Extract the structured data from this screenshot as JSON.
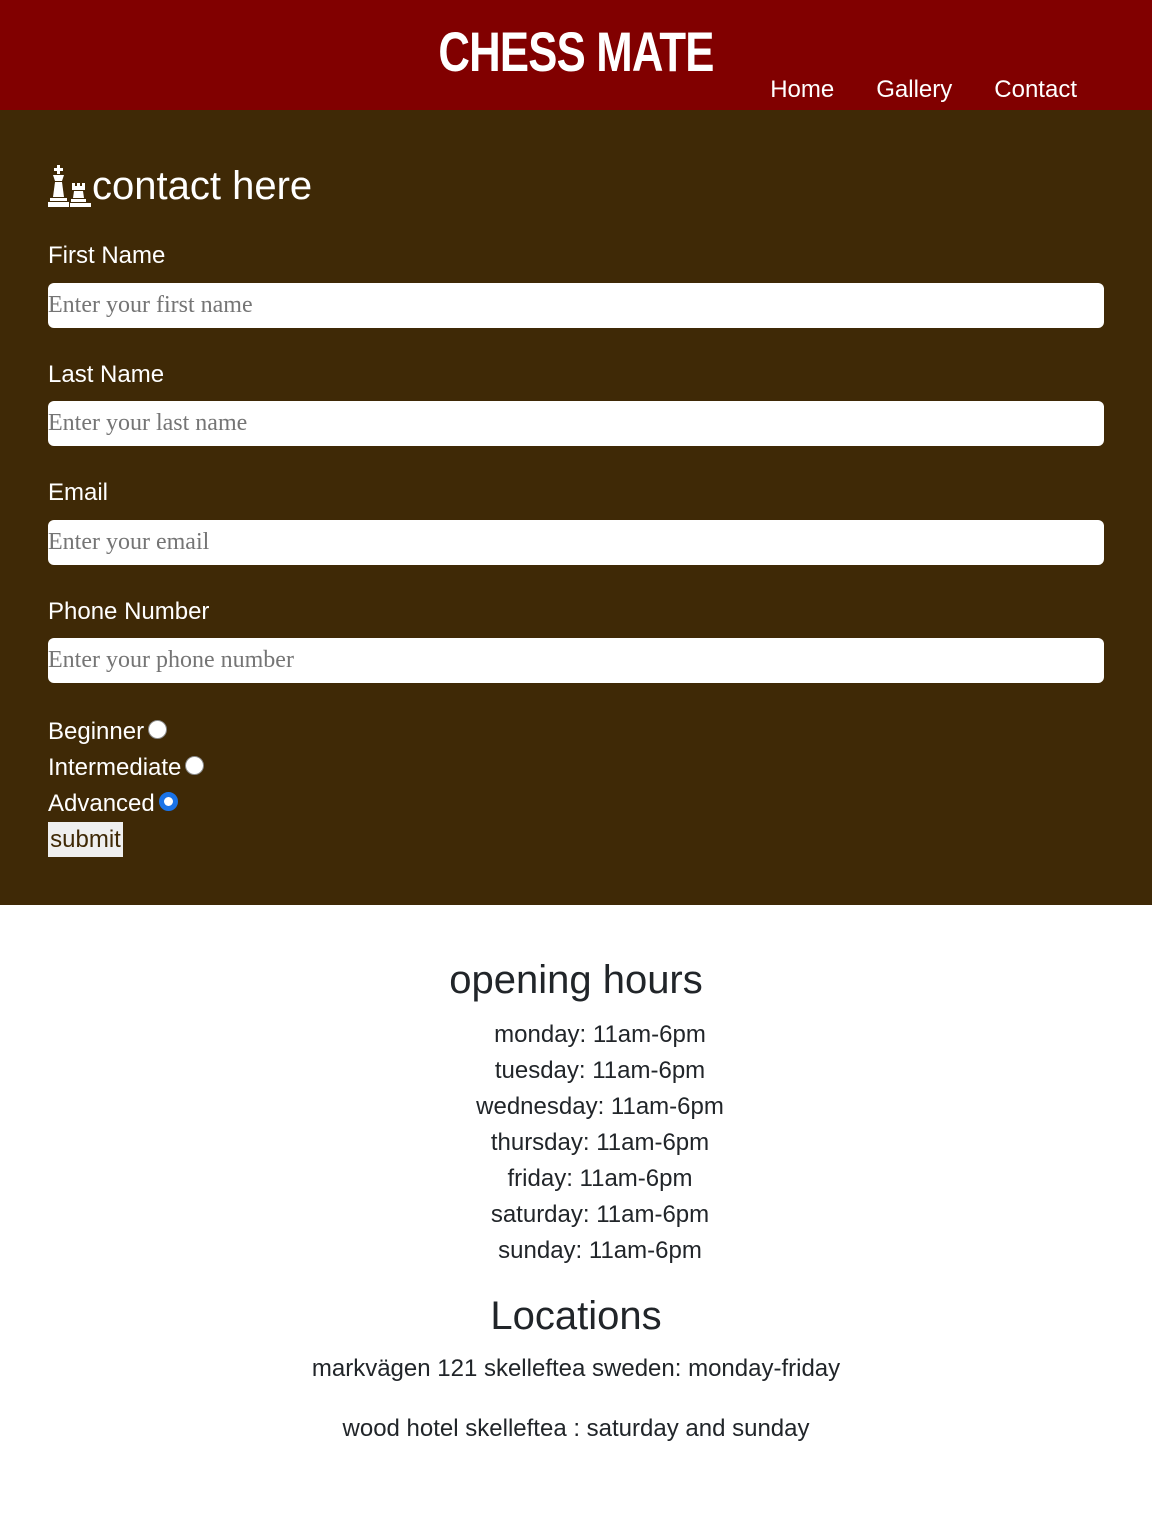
{
  "header": {
    "brand": "CHESS MATE",
    "nav": [
      "Home",
      "Gallery",
      "Contact"
    ]
  },
  "contact": {
    "title": "contact here",
    "fields": [
      {
        "label": "First Name",
        "placeholder": "Enter your first name",
        "value": ""
      },
      {
        "label": "Last Name",
        "placeholder": "Enter your last name",
        "value": ""
      },
      {
        "label": "Email",
        "placeholder": "Enter your email",
        "value": ""
      },
      {
        "label": "Phone Number",
        "placeholder": "Enter your phone number",
        "value": ""
      }
    ],
    "levels": [
      {
        "label": "Beginner",
        "checked": false
      },
      {
        "label": "Intermediate",
        "checked": false
      },
      {
        "label": "Advanced",
        "checked": true
      }
    ],
    "submit_label": "submit"
  },
  "info": {
    "hours_title": "opening hours",
    "hours": [
      "monday: 11am-6pm",
      "tuesday: 11am-6pm",
      "wednesday: 11am-6pm",
      "thursday: 11am-6pm",
      "friday: 11am-6pm",
      "saturday: 11am-6pm",
      "sunday: 11am-6pm"
    ],
    "locations_title": "Locations",
    "locations": [
      "markvägen 121 skelleftea sweden: monday-friday",
      "wood hotel skelleftea : saturday and sunday"
    ]
  },
  "colors": {
    "header_bg": "#810000",
    "contact_bg": "#3f2906",
    "radio_accent": "#1a73e8"
  },
  "icons": [
    "chess-king-icon",
    "chess-rook-icon"
  ]
}
